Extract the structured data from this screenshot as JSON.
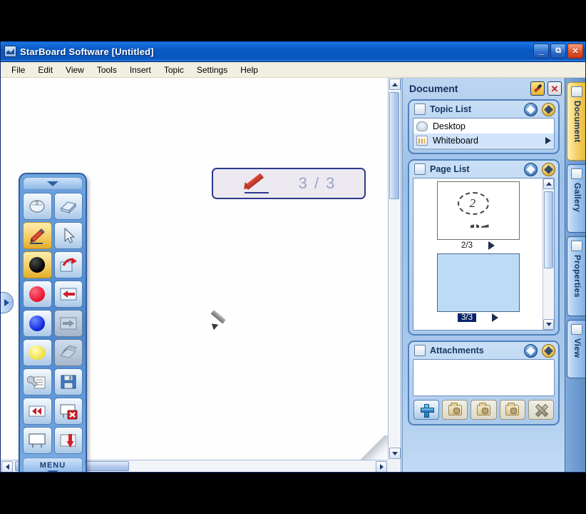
{
  "window": {
    "title": "StarBoard Software [Untitled]",
    "icon": "starboard-app-icon",
    "controls": {
      "minimize": "_",
      "restore": "❐",
      "close": "✕"
    }
  },
  "menubar": {
    "items": [
      {
        "label": "File"
      },
      {
        "label": "Edit"
      },
      {
        "label": "View"
      },
      {
        "label": "Tools"
      },
      {
        "label": "Insert"
      },
      {
        "label": "Topic"
      },
      {
        "label": "Settings"
      },
      {
        "label": "Help"
      }
    ]
  },
  "canvas": {
    "page_indicator": {
      "icon": "red-pen-icon",
      "count": "3 / 3"
    },
    "cursor": "pen-cursor",
    "trash": "recycle-bin-icon",
    "scroll_v": "vertical-scrollbar",
    "scroll_h": "horizontal-scrollbar"
  },
  "left_tab": {
    "icon": "expand-right-arrow-icon"
  },
  "palette": {
    "collapse_handle": "chevron-down-icon",
    "menu_label": "MENU",
    "tools": [
      {
        "name": "mouse-tool",
        "icon": "mouse-icon",
        "selected": false,
        "disabled": false
      },
      {
        "name": "eraser-tool",
        "icon": "eraser-icon",
        "selected": false,
        "disabled": false
      },
      {
        "name": "pen-tool",
        "icon": "pencil-icon",
        "selected": true,
        "disabled": false
      },
      {
        "name": "select-tool",
        "icon": "arrow-pointer-icon",
        "selected": false,
        "disabled": false
      },
      {
        "name": "black-color",
        "icon": "black-circle-icon",
        "selected": true,
        "disabled": false
      },
      {
        "name": "redo-button",
        "icon": "redo-arrow-icon",
        "selected": false,
        "disabled": false
      },
      {
        "name": "red-color",
        "icon": "red-circle-icon",
        "selected": false,
        "disabled": false
      },
      {
        "name": "undo-button",
        "icon": "undo-arrow-icon",
        "selected": false,
        "disabled": false
      },
      {
        "name": "blue-color",
        "icon": "blue-circle-icon",
        "selected": false,
        "disabled": false
      },
      {
        "name": "forward-button",
        "icon": "forward-arrow-icon",
        "selected": false,
        "disabled": true
      },
      {
        "name": "yellow-color",
        "icon": "yellow-circle-icon",
        "selected": false,
        "disabled": false
      },
      {
        "name": "clear-pages-button",
        "icon": "stack-pages-icon",
        "selected": false,
        "disabled": true
      },
      {
        "name": "settings-button",
        "icon": "wrench-list-icon",
        "selected": false,
        "disabled": false
      },
      {
        "name": "save-button",
        "icon": "floppy-disk-icon",
        "selected": false,
        "disabled": false
      },
      {
        "name": "rewind-button",
        "icon": "double-left-icon",
        "selected": false,
        "disabled": false
      },
      {
        "name": "delete-page-button",
        "icon": "board-delete-icon",
        "selected": false,
        "disabled": false
      },
      {
        "name": "new-board-button",
        "icon": "whiteboard-icon",
        "selected": false,
        "disabled": false
      },
      {
        "name": "import-button",
        "icon": "download-arrow-icon",
        "selected": false,
        "disabled": false
      }
    ]
  },
  "document_panel": {
    "title": "Document",
    "pin_button": "pin-icon",
    "close_button": "close-icon",
    "topic_list": {
      "title": "Topic List",
      "icon": "topic-list-icon",
      "buttons": [
        "collapse-icon",
        "expand-icon"
      ],
      "items": [
        {
          "label": "Desktop",
          "icon": "mouse-icon",
          "selected": false
        },
        {
          "label": "Whiteboard",
          "icon": "whiteboard-icon",
          "selected": true
        }
      ]
    },
    "page_list": {
      "title": "Page List",
      "icon": "page-list-icon",
      "buttons": [
        "collapse-icon",
        "expand-icon"
      ],
      "pages": [
        {
          "label": "2/3",
          "selected": false,
          "has_sketch": true
        },
        {
          "label": "3/3",
          "selected": true,
          "has_sketch": false
        }
      ]
    },
    "attachments": {
      "title": "Attachments",
      "icon": "paperclip-icon",
      "buttons": [
        "collapse-icon",
        "expand-icon"
      ],
      "items": [],
      "actions": [
        {
          "name": "add-attachment-button",
          "icon": "plus-icon",
          "disabled": false
        },
        {
          "name": "open-attachment-button",
          "icon": "folder-open-icon",
          "disabled": true
        },
        {
          "name": "save-attachment-button",
          "icon": "folder-save-icon",
          "disabled": true
        },
        {
          "name": "extract-attachment-button",
          "icon": "folder-get-icon",
          "disabled": true
        },
        {
          "name": "delete-attachment-button",
          "icon": "x-icon",
          "disabled": true
        }
      ]
    }
  },
  "tabstrip": {
    "tabs": [
      {
        "label": "Document",
        "icon": "document-icon",
        "active": true
      },
      {
        "label": "Gallery",
        "icon": "gallery-icon",
        "active": false
      },
      {
        "label": "Properties",
        "icon": "properties-icon",
        "active": false
      },
      {
        "label": "View",
        "icon": "view-icon",
        "active": false
      }
    ]
  },
  "colors": {
    "titlebar_blue": "#0b57bd",
    "panel_blue": "#a8c8ec",
    "accent_gold": "#f3ca5c",
    "selection_blue": "#cfe3fa",
    "page_selected": "#0a246a"
  }
}
